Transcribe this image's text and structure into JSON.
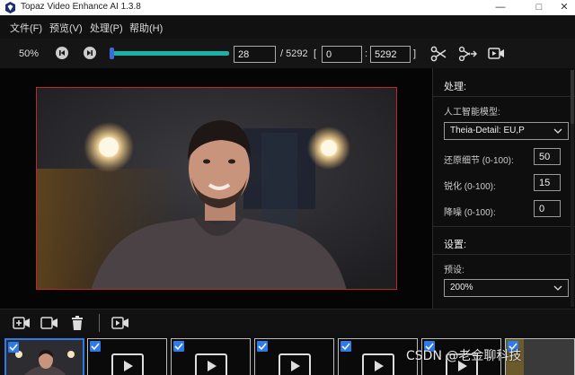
{
  "window": {
    "title": "Topaz Video Enhance AI 1.3.8",
    "minimize_glyph": "—",
    "maximize_glyph": "□",
    "close_glyph": "✕"
  },
  "menu": {
    "items": [
      "文件(F)",
      "预览(V)",
      "处理(P)",
      "帮助(H)"
    ]
  },
  "toolbar": {
    "zoom": "50%",
    "current_frame": "28",
    "total_frames": "/ 5292",
    "range_open": "[",
    "range_start": "0",
    "range_colon": ":",
    "range_end": "5292",
    "range_close": "]",
    "timeline_progress": 0.005
  },
  "panel": {
    "processing_heading": "处理:",
    "ai_model_label": "人工智能模型:",
    "ai_model_value": "Theia-Detail: EU,P",
    "restore_detail_label": "还原细节 (0-100):",
    "restore_detail_value": "50",
    "sharpen_label": "锐化 (0-100):",
    "sharpen_value": "15",
    "denoise_label": "降噪 (0-100):",
    "denoise_value": "0",
    "settings_heading": "设置:",
    "preset_label": "预设:",
    "preset_value": "200%"
  },
  "icons": {
    "skip_start": "skip-start-icon",
    "skip_end": "skip-end-icon",
    "cut": "scissors-icon",
    "split": "split-scissors-icon",
    "camera": "video-camera-icon",
    "add_video": "add-video-icon",
    "record": "video-camera-icon",
    "delete": "trash-icon",
    "export": "export-video-icon"
  },
  "filmstrip": {
    "count": 7
  },
  "watermark": "CSDN @老金聊科技",
  "colors": {
    "accent_blue": "#2e7ae6",
    "timeline_teal": "#19b3a7",
    "preview_border": "#c0252f"
  }
}
